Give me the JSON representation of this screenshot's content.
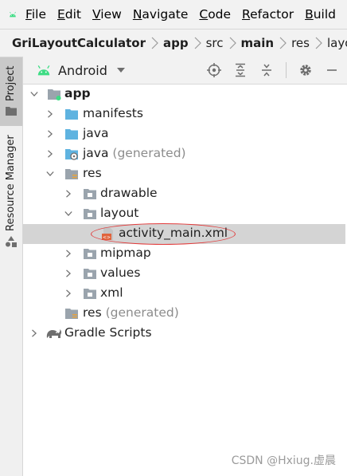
{
  "menu": {
    "file": "F",
    "file_rest": "ile",
    "edit": "E",
    "edit_rest": "dit",
    "view": "V",
    "view_rest": "iew",
    "navigate": "N",
    "navigate_rest": "avigate",
    "code": "C",
    "code_rest": "ode",
    "refactor": "R",
    "refactor_rest": "efactor",
    "build": "B",
    "build_rest": "uild"
  },
  "breadcrumb": [
    "GriLayoutCalculator",
    "app",
    "src",
    "main",
    "res",
    "layout"
  ],
  "stripe": {
    "project": "Project",
    "resource_manager": "Resource Manager"
  },
  "toolbar": {
    "view_label": "Android"
  },
  "tree": {
    "app": "app",
    "manifests": "manifests",
    "java": "java",
    "java_generated_name": "java",
    "java_generated_suffix": "(generated)",
    "res": "res",
    "drawable": "drawable",
    "layout": "layout",
    "activity_main": "activity_main.xml",
    "mipmap": "mipmap",
    "values": "values",
    "xml": "xml",
    "res_generated_name": "res",
    "res_generated_suffix": "(generated)",
    "gradle_scripts": "Gradle Scripts"
  },
  "watermark": "CSDN @Hxiug.虚晨",
  "colors": {
    "android_green": "#3ddc84",
    "folder_blue": "#5fb3e0",
    "folder_gray": "#9aa4ad",
    "selection": "#d4d4d4",
    "annotation_red": "#e23b3b"
  }
}
